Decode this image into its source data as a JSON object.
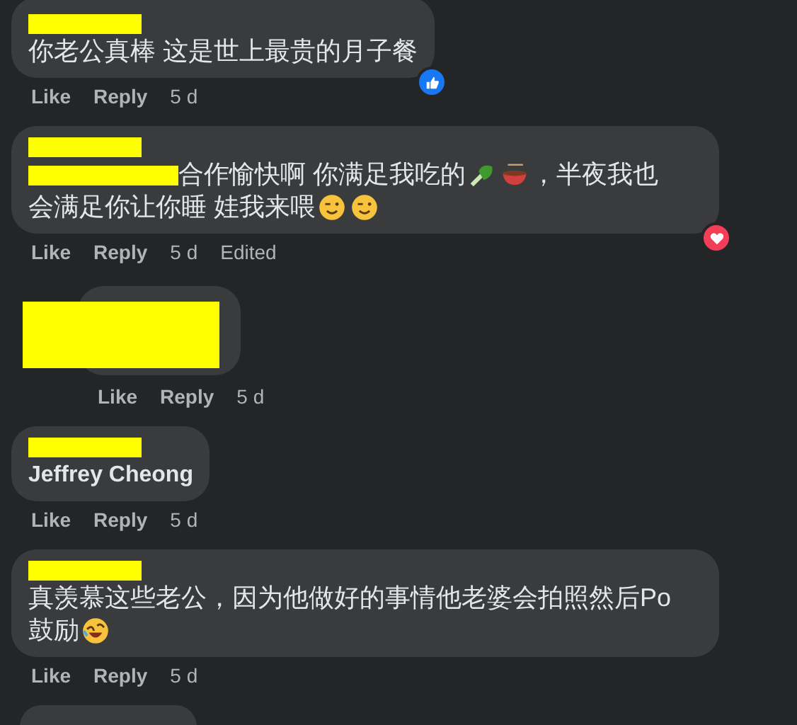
{
  "comments": [
    {
      "kind": "plain",
      "name_redacted": true,
      "lines": [
        [
          {
            "kind": "text",
            "text": "你老公真棒 这是世上最贵的月子餐"
          }
        ]
      ],
      "reaction": {
        "kind": "like"
      },
      "actions": {
        "like": "Like",
        "reply": "Reply",
        "time": "5 d"
      }
    },
    {
      "kind": "plain",
      "name_redacted": true,
      "lines": [
        [
          {
            "kind": "redaction"
          },
          {
            "kind": "text",
            "text": "合作愉快啊 你满足我吃的"
          },
          {
            "kind": "greens"
          },
          {
            "kind": "bowl"
          },
          {
            "kind": "text",
            "text": "，半夜我也"
          }
        ],
        [
          {
            "kind": "text",
            "text": "会满足你让你睡 娃我来喂"
          },
          {
            "kind": "wink"
          },
          {
            "kind": "wink"
          }
        ]
      ],
      "reaction": {
        "kind": "love"
      },
      "actions": {
        "like": "Like",
        "reply": "Reply",
        "time": "5 d",
        "edited": "Edited"
      }
    },
    {
      "kind": "hidden-reply",
      "actions": {
        "like": "Like",
        "reply": "Reply",
        "time": "5 d"
      }
    },
    {
      "kind": "plain",
      "name_redacted": true,
      "lines": [
        [
          {
            "kind": "name",
            "text": "Jeffrey Cheong"
          }
        ]
      ],
      "actions": {
        "like": "Like",
        "reply": "Reply",
        "time": "5 d"
      }
    },
    {
      "kind": "plain",
      "name_redacted": true,
      "lines": [
        [
          {
            "kind": "text",
            "text": "真羡慕这些老公，因为他做好的事情他老婆会拍照然后Po"
          }
        ],
        [
          {
            "kind": "text",
            "text": "鼓励 "
          },
          {
            "kind": "laugh"
          }
        ]
      ],
      "actions": {
        "like": "Like",
        "reply": "Reply",
        "time": "5 d"
      }
    },
    {
      "kind": "stub"
    }
  ]
}
